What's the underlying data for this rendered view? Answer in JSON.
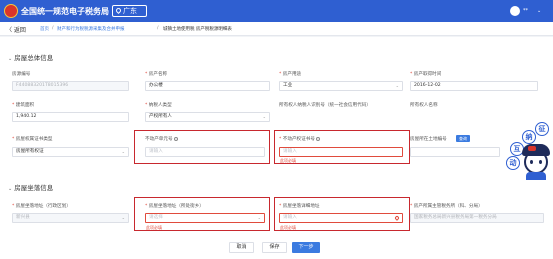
{
  "header": {
    "app_title": "全国统一规范电子税务局",
    "region": "广东",
    "user_name": "**",
    "user_caret": "⌄"
  },
  "subbar": {
    "back_label": "〈 返回",
    "breadcrumb": [
      {
        "label": "首页"
      },
      {
        "label": "/"
      },
      {
        "label": "财产和行为税税源采集及合并申报"
      },
      {
        "label": "/"
      },
      {
        "label": "城镇土地使用税 房产税税源明细表"
      }
    ]
  },
  "section_house_info": {
    "title": "房屋总体信息",
    "fields": {
      "house_id": {
        "label": "房源编号",
        "value": "F440883201T8015396"
      },
      "property_name": {
        "label": "房产名称",
        "value": "办公楼"
      },
      "property_use": {
        "label": "房产用途",
        "value": "工业"
      },
      "acquire_time": {
        "label": "房产取得时间",
        "value": "2016-12-02"
      },
      "building_area": {
        "label": "建筑面积",
        "value": "1,940.12"
      },
      "taxpayer_type": {
        "label": "纳税人类型",
        "value": "产权所有人"
      },
      "owner_tax_id": {
        "label": "所有权人纳税人识别号（统一社会信用代码）"
      },
      "owner_name": {
        "label": "所有权人名称"
      },
      "cert_type": {
        "label": "房屋权属证书类型",
        "value": "房屋所有权证"
      },
      "unit_no": {
        "label": "不动产单元号",
        "placeholder": "请输入"
      },
      "cert_no": {
        "label": "不动产权证书号",
        "placeholder": "请输入",
        "error": "此项必填"
      },
      "land_no": {
        "label": "房屋所在土地编号",
        "query_label": "查询"
      }
    }
  },
  "section_house_location": {
    "title": "房屋坐落信息",
    "fields": {
      "district": {
        "label": "房屋坐落地址（行政区划）",
        "value": "新兴县"
      },
      "address_region": {
        "label": "房屋坐落地址（所处街乡）",
        "placeholder": "请选择",
        "error": "此项必填"
      },
      "detail_address": {
        "label": "房屋坐落详细地址",
        "placeholder": "请输入",
        "error": "此项必填"
      },
      "tax_office": {
        "label": "房产所属主管税务所（科、分局）",
        "value": "国家税务总局新兴县税务局第一税务分局"
      }
    }
  },
  "footer": {
    "cancel_label": "取消",
    "save_label": "保存",
    "next_label": "下一步"
  },
  "mascot": {
    "bubbles": [
      "征",
      "纳",
      "互",
      "动"
    ]
  },
  "colors": {
    "primary": "#2f5fd1",
    "error": "#e04b3d",
    "highlight": "#c8282e"
  }
}
